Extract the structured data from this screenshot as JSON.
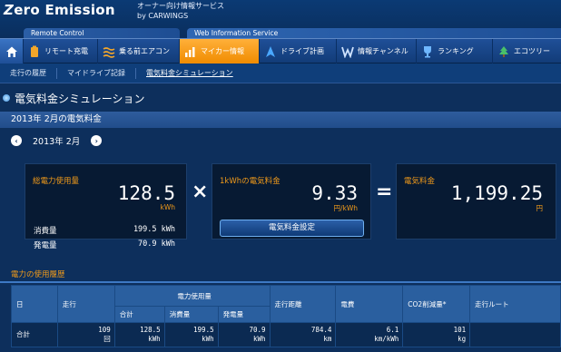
{
  "header": {
    "logo_prefix": "Z",
    "logo_rest": "ero Emission",
    "subtitle_line1": "オーナー向け情報サービス",
    "subtitle_line2": "by CARWINGS",
    "category_remote": "Remote Control",
    "category_web": "Web Information Service"
  },
  "nav": {
    "items": [
      {
        "label": "リモート充電",
        "icon": "battery-icon"
      },
      {
        "label": "乗る前エアコン",
        "icon": "air-icon"
      },
      {
        "label": "マイカー情報",
        "icon": "chart-icon",
        "active": true
      },
      {
        "label": "ドライブ計画",
        "icon": "arrow-icon"
      },
      {
        "label": "情報チャンネル",
        "icon": "channel-icon"
      },
      {
        "label": "ランキング",
        "icon": "trophy-icon"
      },
      {
        "label": "エコツリー",
        "icon": "tree-icon"
      }
    ]
  },
  "subnav": {
    "items": [
      "走行の履歴",
      "マイドライブ記録",
      "電気料金シミュレーション"
    ]
  },
  "page_title": "電気料金シミュレーション",
  "section_title": "2013年 2月の電気料金",
  "month_label": "2013年 2月",
  "card1": {
    "title": "総電力使用量",
    "value": "128.5",
    "unit": "kWh",
    "rows": [
      {
        "label": "消費量",
        "value": "199.5 kWh"
      },
      {
        "label": "発電量",
        "value": "70.9 kWh"
      }
    ]
  },
  "card2": {
    "title": "1kWhの電気料金",
    "value": "9.33",
    "unit": "円/kWh",
    "button": "電気料金設定"
  },
  "card3": {
    "title": "電気料金",
    "value": "1,199.25",
    "unit": "円"
  },
  "operators": {
    "multiply": "×",
    "equals": "="
  },
  "history": {
    "title": "電力の使用履歴",
    "headers": {
      "day": "日",
      "run": "走行",
      "power": "電力使用量",
      "distance": "走行距離",
      "efficiency": "電費",
      "co2": "CO2削減量*",
      "route": "走行ルート",
      "total": "合計",
      "consumption": "消費量",
      "generation": "発電量"
    },
    "row": {
      "label": "合計",
      "run": "109",
      "run_unit": "回",
      "total": "128.5",
      "total_unit": "kWh",
      "consumption": "199.5",
      "consumption_unit": "kWh",
      "generation": "70.9",
      "generation_unit": "kWh",
      "distance": "784.4",
      "distance_unit": "km",
      "efficiency": "6.1",
      "efficiency_unit": "km/kWh",
      "co2": "101",
      "co2_unit": "kg"
    }
  },
  "colors": {
    "accent": "#f09a1a",
    "background": "#0d2f5c",
    "card": "#071a33"
  }
}
